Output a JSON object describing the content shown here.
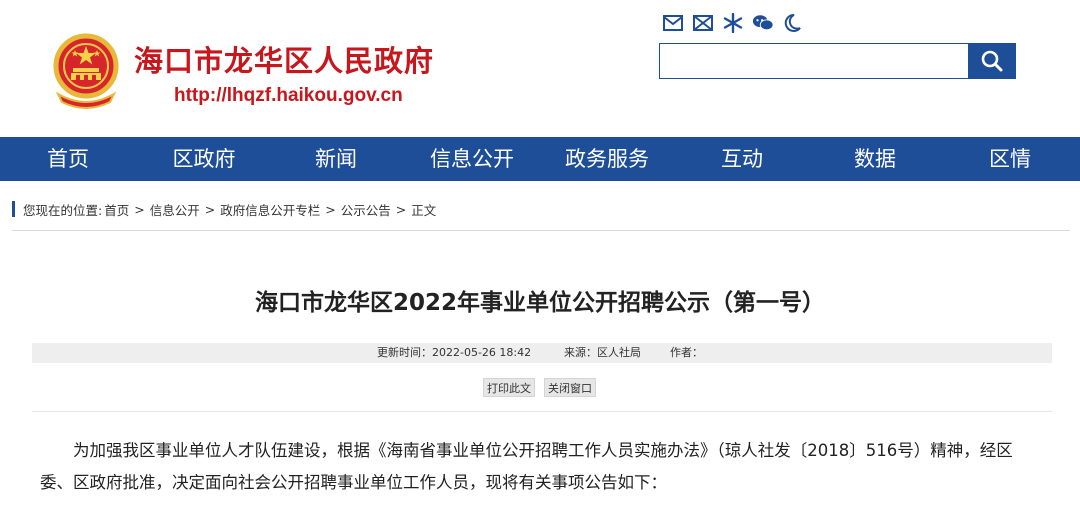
{
  "header": {
    "site_title": "海口市龙华区人民政府",
    "site_url": "http://lhqzf.haikou.gov.cn",
    "tool_icons": [
      "mail-icon",
      "envelope-icon",
      "snowflake-icon",
      "wechat-icon",
      "moon-icon"
    ],
    "search": {
      "value": "",
      "placeholder": ""
    }
  },
  "nav": {
    "items": [
      "首页",
      "区政府",
      "新闻",
      "信息公开",
      "政务服务",
      "互动",
      "数据",
      "区情"
    ]
  },
  "breadcrumb": {
    "prefix": "您现在的位置:",
    "items": [
      "首页",
      "信息公开",
      "政府信息公开专栏",
      "公示公告",
      "正文"
    ],
    "separator": ">"
  },
  "article": {
    "title": "海口市龙华区2022年事业单位公开招聘公示（第一号）",
    "update_time": "更新时间：2022-05-26 18:42",
    "source": "来源：区人社局",
    "author": "作者：",
    "print_label": "打印此文",
    "close_label": "关闭窗口",
    "paragraph": "为加强我区事业单位人才队伍建设，根据《海南省事业单位公开招聘工作人员实施办法》（琼人社发〔2018〕516号）精神，经区委、区政府批准，决定面向社会公开招聘事业单位工作人员，现将有关事项公告如下："
  },
  "colors": {
    "brand_red": "#c8161d",
    "nav_blue": "#1f4e99",
    "meta_gray": "#eeeeee"
  }
}
